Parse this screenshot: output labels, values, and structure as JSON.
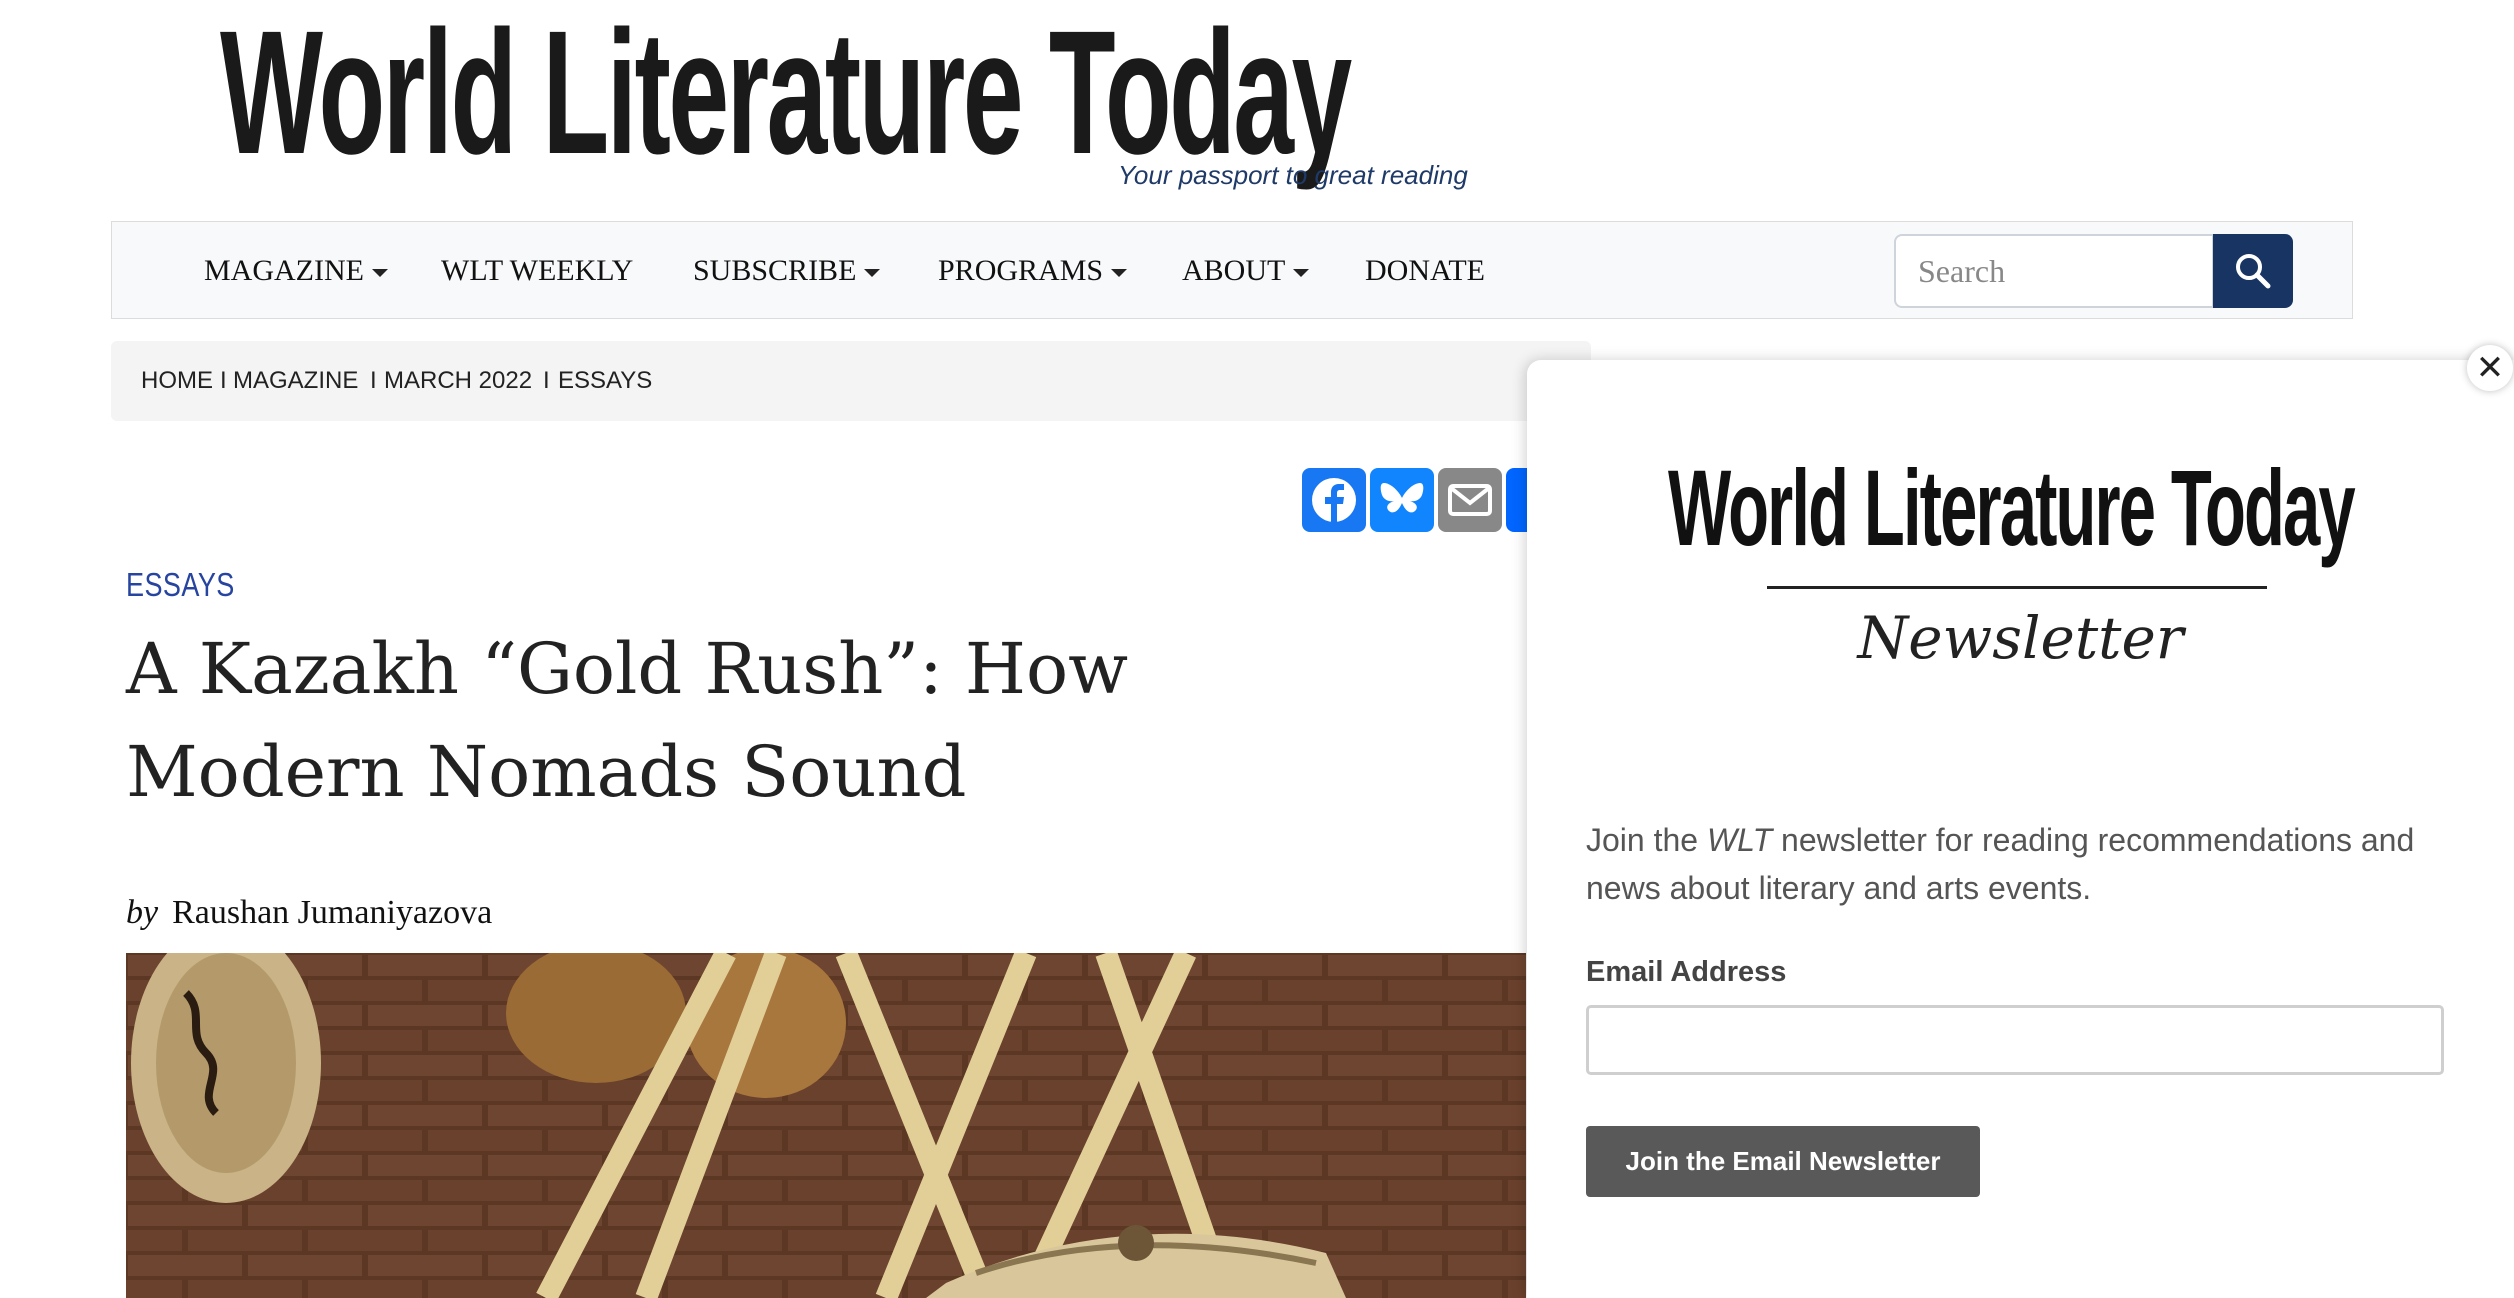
{
  "masthead": {
    "logo_text": "World Literature Today",
    "tagline": "Your passport to great reading"
  },
  "nav": {
    "items": [
      {
        "label": "MAGAZINE",
        "dropdown": true
      },
      {
        "label": "WLT WEEKLY",
        "dropdown": false
      },
      {
        "label": "SUBSCRIBE",
        "dropdown": true
      },
      {
        "label": "PROGRAMS",
        "dropdown": true
      },
      {
        "label": "ABOUT",
        "dropdown": true
      },
      {
        "label": "DONATE",
        "dropdown": false
      }
    ],
    "search_placeholder": "Search",
    "search_icon": "search-icon"
  },
  "breadcrumb": {
    "items": [
      "HOME",
      "MAGAZINE",
      "MARCH 2022",
      "ESSAYS"
    ],
    "separator": "I"
  },
  "share": {
    "items": [
      {
        "name": "facebook-icon",
        "color": "#1877f2"
      },
      {
        "name": "bluesky-icon",
        "color": "#1185fe"
      },
      {
        "name": "email-icon",
        "color": "#888888"
      },
      {
        "name": "share-icon",
        "color": "#0166ff"
      }
    ]
  },
  "article": {
    "category": "ESSAYS",
    "title": "A Kazakh “Gold Rush”: How Modern Nomads Sound",
    "by": "by",
    "author": "Raushan Jumaniyazova"
  },
  "newsletter": {
    "close_symbol": "✕",
    "logo_text": "World Literature Today",
    "logo_subtitle": "Newsletter",
    "desc_prefix": "Join the ",
    "desc_italic": "WLT",
    "desc_suffix": " newsletter for reading recommendations and news about literary and arts events.",
    "email_label": "Email Address",
    "email_value": "",
    "button_label": "Join the Email Newsletter"
  },
  "colors": {
    "nav_bg": "#f8f9fa",
    "search_button": "#173463",
    "category": "#2745a0",
    "tagline": "#1f3a68",
    "newsletter_button": "#595959"
  }
}
